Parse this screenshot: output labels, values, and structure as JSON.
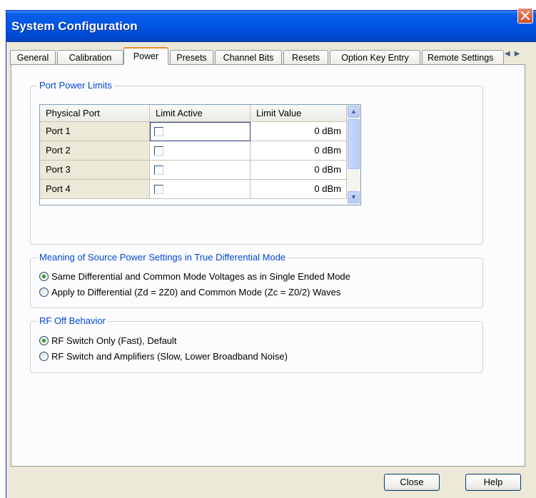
{
  "window": {
    "title": "System Configuration"
  },
  "tabs": [
    "General",
    "Calibration",
    "Power",
    "Presets",
    "Channel Bits",
    "Resets",
    "Option Key Entry",
    "Remote Settings"
  ],
  "active_tab": "Power",
  "tab_scroll_icons": [
    "left-arrow-icon",
    "right-arrow-icon"
  ],
  "port_power_limits": {
    "label": "Port Power Limits",
    "columns": [
      "Physical Port",
      "Limit Active",
      "Limit Value"
    ],
    "rows": [
      {
        "port": "Port 1",
        "limit_active": false,
        "limit_value": "0 dBm"
      },
      {
        "port": "Port 2",
        "limit_active": false,
        "limit_value": "0 dBm"
      },
      {
        "port": "Port 3",
        "limit_active": false,
        "limit_value": "0 dBm"
      },
      {
        "port": "Port 4",
        "limit_active": false,
        "limit_value": "0 dBm"
      }
    ]
  },
  "differential_mode": {
    "label": "Meaning of Source Power Settings in True Differential Mode",
    "options": [
      {
        "label": "Same Differential and Common Mode Voltages as in Single Ended Mode",
        "selected": true
      },
      {
        "label": "Apply to Differential (Zd = 2Z0) and Common Mode (Zc = Z0/2) Waves",
        "selected": false
      }
    ]
  },
  "rf_off_behavior": {
    "label": "RF Off Behavior",
    "options": [
      {
        "label": "RF Switch Only (Fast), Default",
        "selected": true
      },
      {
        "label": "RF Switch and Amplifiers (Slow, Lower Broadband Noise)",
        "selected": false
      }
    ]
  },
  "buttons": {
    "close": "Close",
    "help": "Help"
  },
  "colors": {
    "titlebar": "#0055e5",
    "group_label": "#0046d5",
    "active_tab_accent": "#e68b2c",
    "radio_dot": "#21a121"
  }
}
